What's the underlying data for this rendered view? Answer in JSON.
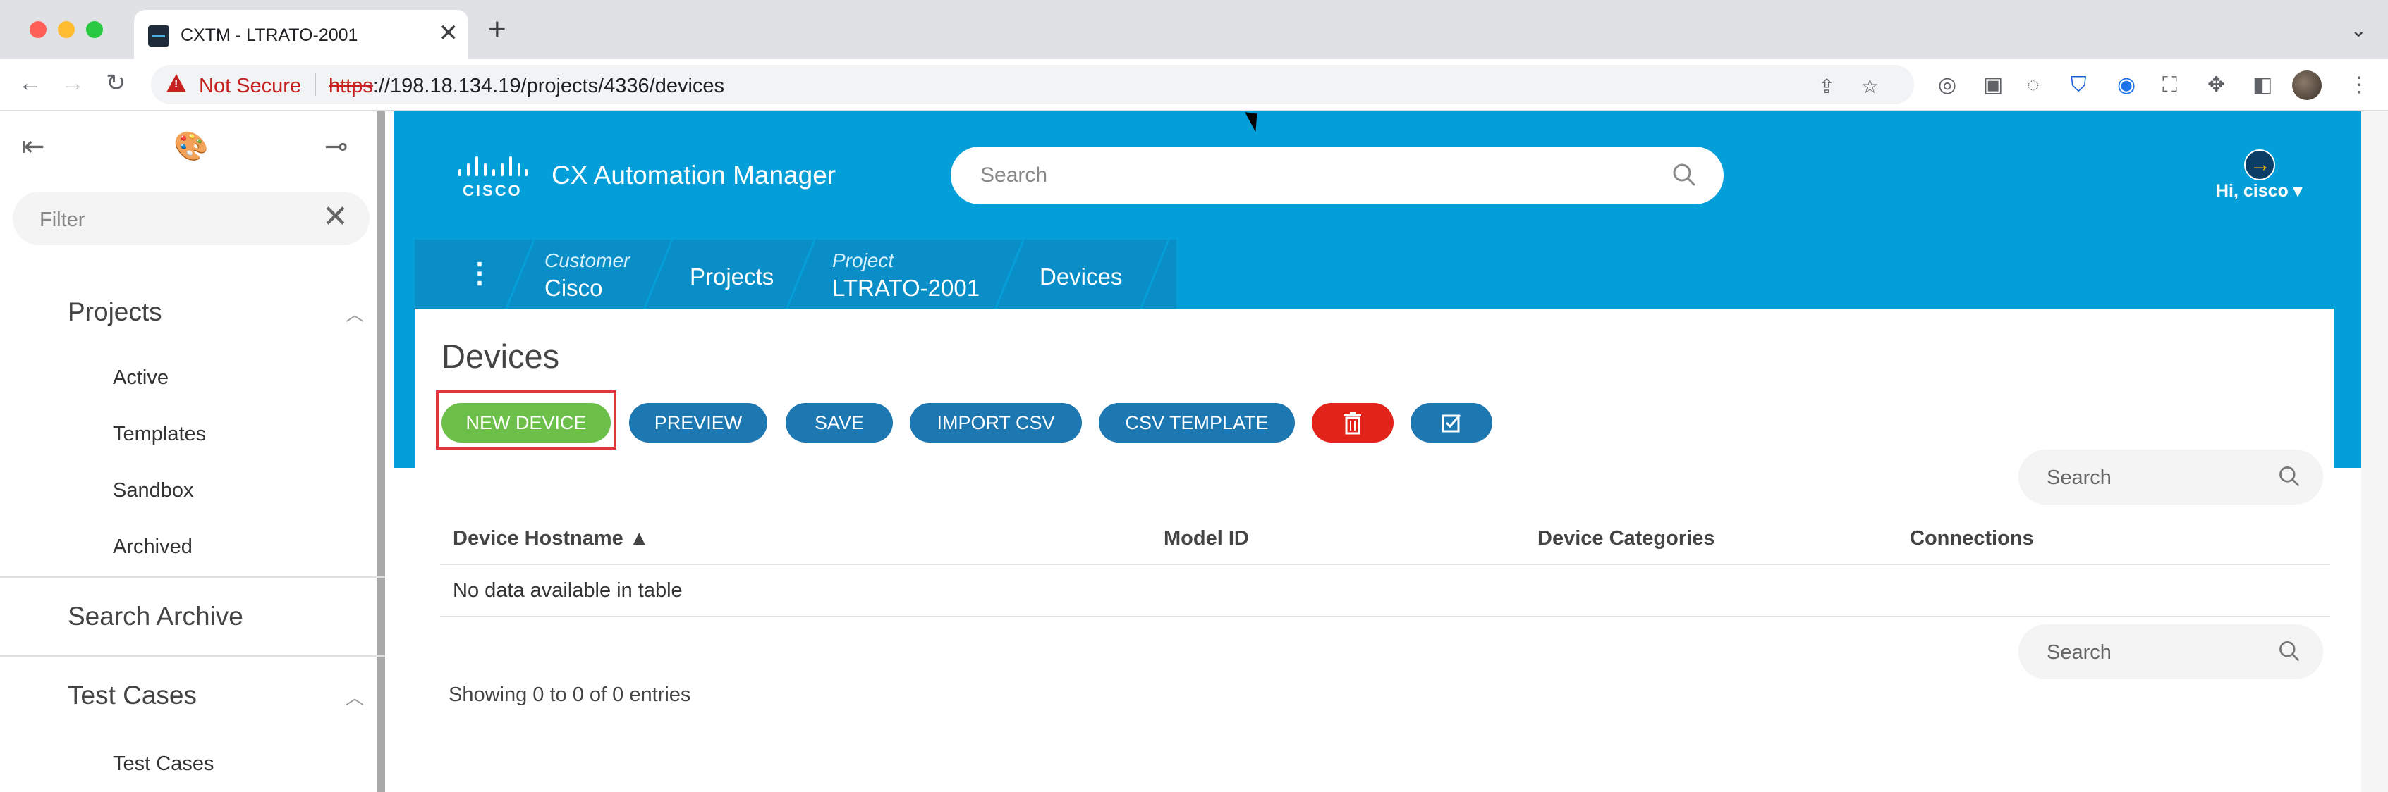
{
  "browser": {
    "tab_title": "CXTM - LTRATO-2001",
    "new_tab": "+",
    "tab_close": "✕",
    "security_label": "Not Secure",
    "url_scheme": "https",
    "url_rest": "://198.18.134.19/projects/4336/devices"
  },
  "sidebar": {
    "filter_placeholder": "Filter",
    "projects_label": "Projects",
    "project_items": [
      "Active",
      "Templates",
      "Sandbox",
      "Archived"
    ],
    "search_archive_label": "Search Archive",
    "test_cases_label": "Test Cases",
    "test_case_items": [
      "Test Cases"
    ]
  },
  "header": {
    "logo_text": "CISCO",
    "app_title": "CX Automation Manager",
    "search_placeholder": "Search",
    "user_greeting": "Hi, cisco ▾"
  },
  "breadcrumb": {
    "customer_label": "Customer",
    "customer_value": "Cisco",
    "projects": "Projects",
    "project_label": "Project",
    "project_value": "LTRATO-2001",
    "devices": "Devices"
  },
  "main": {
    "title": "Devices",
    "buttons": {
      "new_device": "NEW DEVICE",
      "preview": "PREVIEW",
      "save": "SAVE",
      "import_csv": "IMPORT CSV",
      "csv_template": "CSV TEMPLATE"
    },
    "table_search_placeholder": "Search",
    "columns": [
      "Device Hostname ▲",
      "Model ID",
      "Device Categories",
      "Connections"
    ],
    "empty_message": "No data available in table",
    "showing": "Showing 0 to 0 of 0 entries"
  },
  "colors": {
    "header_blue": "#049fd9",
    "breadcrumb_blue": "#0a8ec7",
    "button_blue": "#1d77b0",
    "new_device_green": "#6cc04a",
    "delete_red": "#e2231a"
  }
}
